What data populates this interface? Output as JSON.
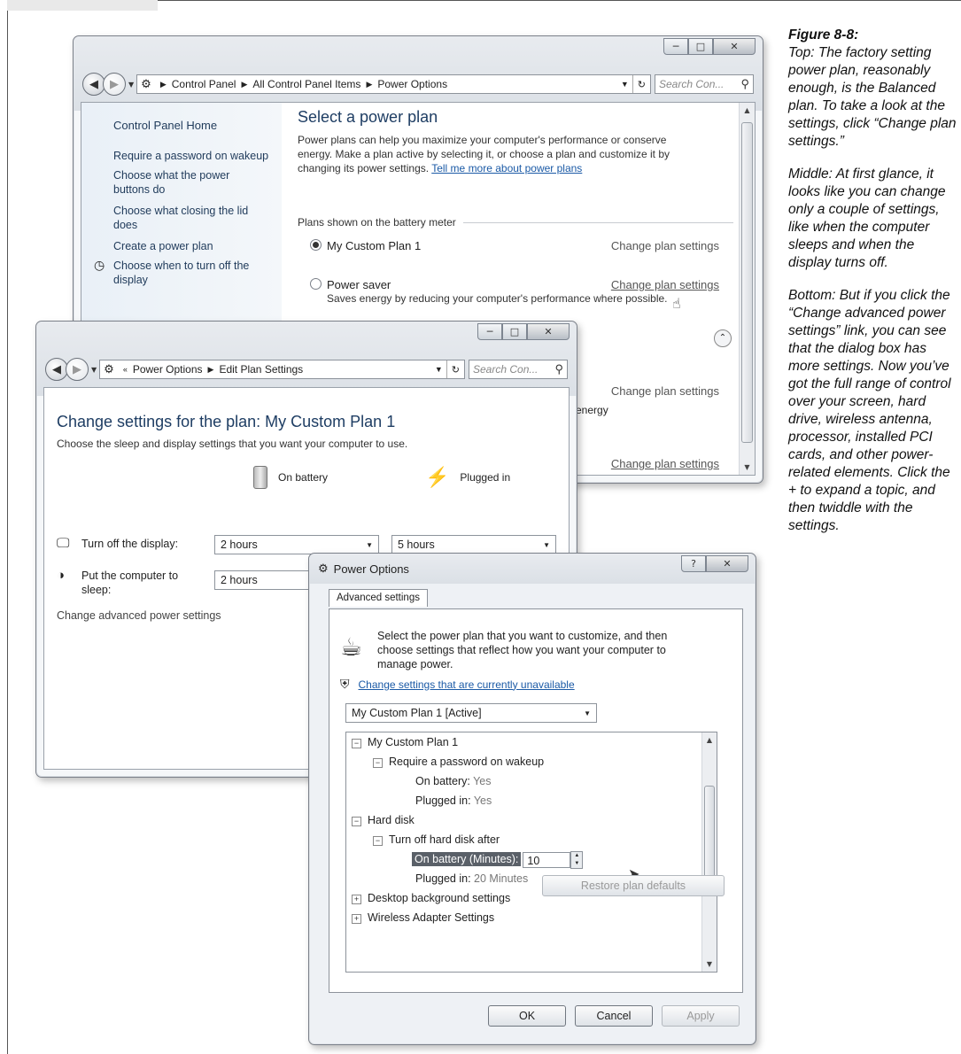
{
  "caption": {
    "figure": "Figure 8-8:",
    "top": "Top: The factory setting power plan, reasonably enough, is the Balanced plan. To take a look at the settings, click “Change plan settings.”",
    "middle": "Middle: At first glance, it looks like you can change only a couple of settings, like when the computer sleeps and when the display turns off.",
    "bottom": "Bottom: But if you click the “Change advanced power settings” link, you can see that the dialog box has more settings. Now you’ve got the full range of control over your screen, hard drive, wireless antenna, processor, installed PCI cards, and other power-related elements. Click the + to expand a topic, and then twiddle with the settings."
  },
  "window1": {
    "breadcrumb": [
      "Control Panel",
      "All Control Panel Items",
      "Power Options"
    ],
    "search_placeholder": "Search Con...",
    "sidebar": {
      "home": "Control Panel Home",
      "items": [
        "Require a password on wakeup",
        "Choose what the power buttons do",
        "Choose what closing the lid does",
        "Create a power plan",
        "Choose when to turn off the display"
      ]
    },
    "title": "Select a power plan",
    "description": "Power plans can help you maximize your computer's performance or conserve energy. Make a plan active by selecting it, or choose a plan and customize it by changing its power settings.",
    "learn_link": "Tell me more about power plans",
    "group_label": "Plans shown on the battery meter",
    "plans": [
      {
        "name": "My Custom Plan 1",
        "action": "Change plan settings",
        "selected": true
      },
      {
        "name": "Power saver",
        "action": "Change plan settings",
        "desc": "Saves energy by reducing your computer's performance where possible.",
        "selected": false
      }
    ],
    "partial_action_1": "Change plan settings",
    "partial_desc": "h energy",
    "partial_action_2": "Change plan settings"
  },
  "window2": {
    "breadcrumb": [
      "Power Options",
      "Edit Plan Settings"
    ],
    "search_placeholder": "Search Con...",
    "title": "Change settings for the plan: My Custom Plan 1",
    "subtitle": "Choose the sleep and display settings that you want your computer to use.",
    "col_battery": "On battery",
    "col_plugged": "Plugged in",
    "display_label": "Turn off the display:",
    "display_battery": "2 hours",
    "display_plugged": "5 hours",
    "sleep_label": "Put the computer to sleep:",
    "sleep_battery": "2 hours",
    "advanced_link": "Change advanced power settings"
  },
  "dialog": {
    "title": "Power Options",
    "tab": "Advanced settings",
    "intro": "Select the power plan that you want to customize, and then choose settings that reflect how you want your computer to manage power.",
    "unavailable_link": "Change settings that are currently unavailable",
    "plan_select": "My Custom Plan 1 [Active]",
    "tree": {
      "plan": "My Custom Plan 1",
      "password": "Require a password on wakeup",
      "pw_battery_label": "On battery:",
      "pw_battery_val": "Yes",
      "pw_plugged_label": "Plugged in:",
      "pw_plugged_val": "Yes",
      "hard_disk": "Hard disk",
      "turn_off_hd": "Turn off hard disk after",
      "hd_battery_label": "On battery (Minutes):",
      "hd_battery_val": "10",
      "hd_plugged_label": "Plugged in:",
      "hd_plugged_val": "20 Minutes",
      "desktop_bg": "Desktop background settings",
      "wireless": "Wireless Adapter Settings"
    },
    "restore_button": "Restore plan defaults",
    "ok": "OK",
    "cancel": "Cancel",
    "apply": "Apply"
  }
}
